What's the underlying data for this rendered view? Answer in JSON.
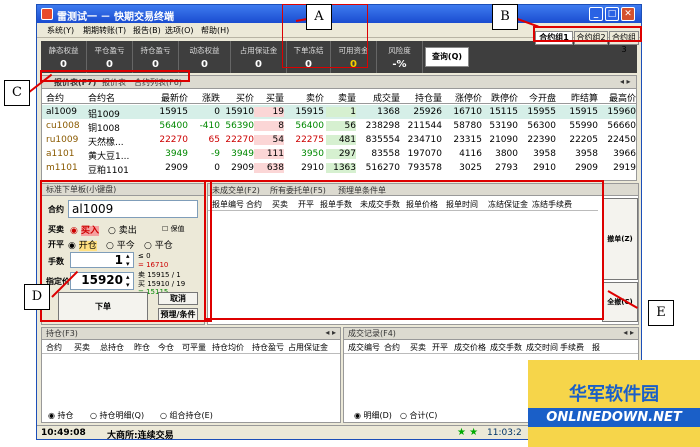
{
  "window": {
    "title": "雷测试一 － 快期交易终端",
    "min": "_",
    "max": "□",
    "close": "✕"
  },
  "menu": [
    "系统(Y)",
    "期期转账(T)",
    "报告(B)",
    "选项(O)",
    "帮助(H)"
  ],
  "account": [
    {
      "label": "静态权益",
      "value": "0"
    },
    {
      "label": "平仓盈亏",
      "value": "0"
    },
    {
      "label": "持仓盈亏",
      "value": "0"
    },
    {
      "label": "动态权益",
      "value": "0"
    },
    {
      "label": "占用保证金",
      "value": "0"
    },
    {
      "label": "下单冻结",
      "value": "0"
    },
    {
      "label": "可用资金",
      "value": "0"
    },
    {
      "label": "风险度",
      "value": "-%"
    }
  ],
  "query_btn": "查询(Q)",
  "contract_groups": [
    "合约组1",
    "合约组2",
    "合约组3"
  ],
  "market": {
    "tabs": [
      "报价表(F7)",
      "报价表",
      "合约列表(F6)"
    ],
    "headers": [
      "合约",
      "合约名",
      "最新价",
      "涨跌",
      "买价",
      "买量",
      "卖价",
      "卖量",
      "成交量",
      "持仓量",
      "涨停价",
      "跌停价",
      "今开盘",
      "昨结算",
      "最高价"
    ],
    "rows": [
      [
        "al1009",
        "铝1009",
        "15915",
        "0",
        "15910",
        "19",
        "15915",
        "1",
        "1368",
        "25926",
        "16710",
        "15115",
        "15955",
        "15915",
        "15960"
      ],
      [
        "cu1008",
        "铜1008",
        "56400",
        "-410",
        "56390",
        "8",
        "56400",
        "56",
        "238298",
        "211544",
        "58780",
        "53190",
        "56300",
        "55990",
        "56660"
      ],
      [
        "ru1009",
        "天然橡...",
        "22270",
        "65",
        "22270",
        "54",
        "22275",
        "481",
        "835554",
        "234710",
        "23315",
        "21090",
        "22390",
        "22205",
        "22450"
      ],
      [
        "a1101",
        "黄大豆1...",
        "3949",
        "-9",
        "3949",
        "111",
        "3950",
        "297",
        "83558",
        "197070",
        "4116",
        "3800",
        "3958",
        "3958",
        "3966"
      ],
      [
        "m1101",
        "豆粕1101",
        "2909",
        "0",
        "2909",
        "638",
        "2910",
        "1363",
        "516270",
        "793578",
        "3025",
        "2793",
        "2910",
        "2909",
        "2919"
      ]
    ]
  },
  "order": {
    "header": "标准下单板(小键盘)",
    "contract_label": "合约",
    "contract_value": "al1009",
    "bs_label": "买卖",
    "buy": "买入",
    "sell": "卖出",
    "protect": "保值",
    "oc_label": "开平",
    "open": "开仓",
    "close_today": "平今",
    "close": "平仓",
    "qty_label": "手数",
    "qty": "1",
    "price_label": "指定价",
    "price": "15920",
    "limit_lines": [
      "≤ 0",
      "= 16710",
      "卖 15915 / 1",
      "买 15910 / 19",
      "= 15115"
    ],
    "order_btn": "下单",
    "cancel_btn": "取消",
    "preset_btn": "预埋/条件"
  },
  "orders_panel": {
    "tabs": [
      "未成交单(F2)",
      "所有委托单(F5)",
      "预埋单条件单"
    ],
    "headers": [
      "报单编号",
      "合约",
      "买卖",
      "开平",
      "报单手数",
      "未成交手数",
      "报单价格",
      "报单时间",
      "冻结保证金",
      "冻结手续费"
    ],
    "cancel_btn": "撤单(Z)",
    "cancel_all_btn": "全撤(C)"
  },
  "positions": {
    "header": "持仓(F3)",
    "headers": [
      "合约",
      "买卖",
      "总持仓",
      "昨仓",
      "今仓",
      "可平量",
      "持仓均价",
      "持仓盈亏",
      "占用保证金"
    ],
    "radios": [
      "持仓",
      "持仓明细(Q)",
      "组合持仓(E)"
    ]
  },
  "trades": {
    "header": "成交记录(F4)",
    "headers": [
      "成交编号",
      "合约",
      "买卖",
      "开平",
      "成交价格",
      "成交手数",
      "成交时间",
      "手续费",
      "报"
    ],
    "radios": [
      "明细(D)",
      "合计(C)"
    ]
  },
  "status": {
    "time": "10:49:08",
    "broker": "大商所:连续交易",
    "time2": "11:03:2"
  },
  "annotations": [
    "A",
    "B",
    "C",
    "D",
    "E"
  ],
  "watermark": {
    "line1": "华军软件园",
    "line2": "ONLINEDOWN.NET"
  },
  "colors": {
    "up": "#cc0000",
    "down": "#008800",
    "title": "#1a4cd0"
  }
}
